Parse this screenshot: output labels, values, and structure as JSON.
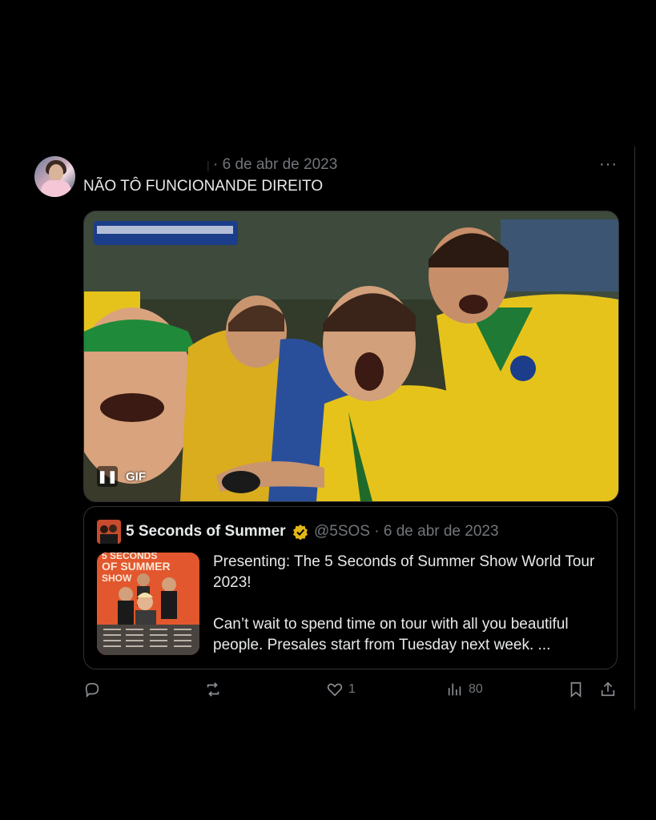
{
  "tweet": {
    "date": "· 6 de abr de 2023",
    "text": "NÃO TÔ FUNCIONANDE DIREITO",
    "more_label": "···",
    "media": {
      "gif_label": "GIF",
      "pause_label": "❚❚"
    }
  },
  "quote": {
    "name": "5 Seconds of Summer",
    "handle_date": "@5SOS · 6 de abr de 2023",
    "paragraph1": "Presenting: The 5 Seconds of Summer Show World Tour 2023!",
    "paragraph2": "Can’t wait to spend time on tour with all you beautiful people. Presales start from Tuesday next week. ...",
    "poster_text": "5 SECONDS OF SUMMER SHOW"
  },
  "actions": {
    "likes": "1",
    "views": "80"
  },
  "colors": {
    "background": "#000000",
    "muted": "#71767b",
    "verified": "#e2b719"
  }
}
